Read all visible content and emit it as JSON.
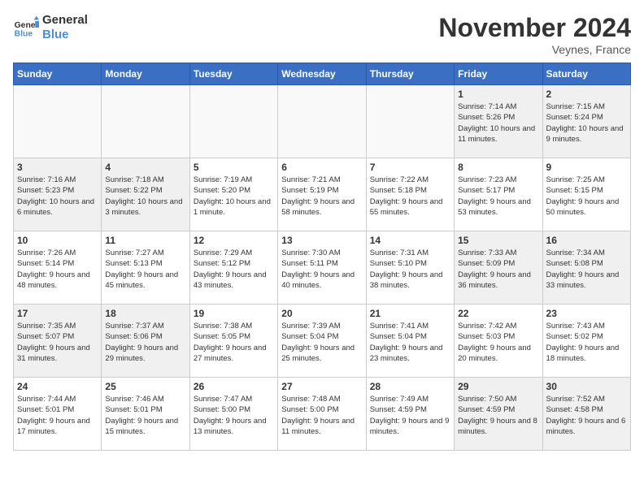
{
  "header": {
    "logo_general": "General",
    "logo_blue": "Blue",
    "month_title": "November 2024",
    "location": "Veynes, France"
  },
  "weekdays": [
    "Sunday",
    "Monday",
    "Tuesday",
    "Wednesday",
    "Thursday",
    "Friday",
    "Saturday"
  ],
  "weeks": [
    [
      {
        "day": "",
        "empty": true
      },
      {
        "day": "",
        "empty": true
      },
      {
        "day": "",
        "empty": true
      },
      {
        "day": "",
        "empty": true
      },
      {
        "day": "",
        "empty": true
      },
      {
        "day": "1",
        "sunrise": "Sunrise: 7:14 AM",
        "sunset": "Sunset: 5:26 PM",
        "daylight": "Daylight: 10 hours and 11 minutes."
      },
      {
        "day": "2",
        "sunrise": "Sunrise: 7:15 AM",
        "sunset": "Sunset: 5:24 PM",
        "daylight": "Daylight: 10 hours and 9 minutes."
      }
    ],
    [
      {
        "day": "3",
        "sunrise": "Sunrise: 7:16 AM",
        "sunset": "Sunset: 5:23 PM",
        "daylight": "Daylight: 10 hours and 6 minutes."
      },
      {
        "day": "4",
        "sunrise": "Sunrise: 7:18 AM",
        "sunset": "Sunset: 5:22 PM",
        "daylight": "Daylight: 10 hours and 3 minutes."
      },
      {
        "day": "5",
        "sunrise": "Sunrise: 7:19 AM",
        "sunset": "Sunset: 5:20 PM",
        "daylight": "Daylight: 10 hours and 1 minute."
      },
      {
        "day": "6",
        "sunrise": "Sunrise: 7:21 AM",
        "sunset": "Sunset: 5:19 PM",
        "daylight": "Daylight: 9 hours and 58 minutes."
      },
      {
        "day": "7",
        "sunrise": "Sunrise: 7:22 AM",
        "sunset": "Sunset: 5:18 PM",
        "daylight": "Daylight: 9 hours and 55 minutes."
      },
      {
        "day": "8",
        "sunrise": "Sunrise: 7:23 AM",
        "sunset": "Sunset: 5:17 PM",
        "daylight": "Daylight: 9 hours and 53 minutes."
      },
      {
        "day": "9",
        "sunrise": "Sunrise: 7:25 AM",
        "sunset": "Sunset: 5:15 PM",
        "daylight": "Daylight: 9 hours and 50 minutes."
      }
    ],
    [
      {
        "day": "10",
        "sunrise": "Sunrise: 7:26 AM",
        "sunset": "Sunset: 5:14 PM",
        "daylight": "Daylight: 9 hours and 48 minutes."
      },
      {
        "day": "11",
        "sunrise": "Sunrise: 7:27 AM",
        "sunset": "Sunset: 5:13 PM",
        "daylight": "Daylight: 9 hours and 45 minutes."
      },
      {
        "day": "12",
        "sunrise": "Sunrise: 7:29 AM",
        "sunset": "Sunset: 5:12 PM",
        "daylight": "Daylight: 9 hours and 43 minutes."
      },
      {
        "day": "13",
        "sunrise": "Sunrise: 7:30 AM",
        "sunset": "Sunset: 5:11 PM",
        "daylight": "Daylight: 9 hours and 40 minutes."
      },
      {
        "day": "14",
        "sunrise": "Sunrise: 7:31 AM",
        "sunset": "Sunset: 5:10 PM",
        "daylight": "Daylight: 9 hours and 38 minutes."
      },
      {
        "day": "15",
        "sunrise": "Sunrise: 7:33 AM",
        "sunset": "Sunset: 5:09 PM",
        "daylight": "Daylight: 9 hours and 36 minutes."
      },
      {
        "day": "16",
        "sunrise": "Sunrise: 7:34 AM",
        "sunset": "Sunset: 5:08 PM",
        "daylight": "Daylight: 9 hours and 33 minutes."
      }
    ],
    [
      {
        "day": "17",
        "sunrise": "Sunrise: 7:35 AM",
        "sunset": "Sunset: 5:07 PM",
        "daylight": "Daylight: 9 hours and 31 minutes."
      },
      {
        "day": "18",
        "sunrise": "Sunrise: 7:37 AM",
        "sunset": "Sunset: 5:06 PM",
        "daylight": "Daylight: 9 hours and 29 minutes."
      },
      {
        "day": "19",
        "sunrise": "Sunrise: 7:38 AM",
        "sunset": "Sunset: 5:05 PM",
        "daylight": "Daylight: 9 hours and 27 minutes."
      },
      {
        "day": "20",
        "sunrise": "Sunrise: 7:39 AM",
        "sunset": "Sunset: 5:04 PM",
        "daylight": "Daylight: 9 hours and 25 minutes."
      },
      {
        "day": "21",
        "sunrise": "Sunrise: 7:41 AM",
        "sunset": "Sunset: 5:04 PM",
        "daylight": "Daylight: 9 hours and 23 minutes."
      },
      {
        "day": "22",
        "sunrise": "Sunrise: 7:42 AM",
        "sunset": "Sunset: 5:03 PM",
        "daylight": "Daylight: 9 hours and 20 minutes."
      },
      {
        "day": "23",
        "sunrise": "Sunrise: 7:43 AM",
        "sunset": "Sunset: 5:02 PM",
        "daylight": "Daylight: 9 hours and 18 minutes."
      }
    ],
    [
      {
        "day": "24",
        "sunrise": "Sunrise: 7:44 AM",
        "sunset": "Sunset: 5:01 PM",
        "daylight": "Daylight: 9 hours and 17 minutes."
      },
      {
        "day": "25",
        "sunrise": "Sunrise: 7:46 AM",
        "sunset": "Sunset: 5:01 PM",
        "daylight": "Daylight: 9 hours and 15 minutes."
      },
      {
        "day": "26",
        "sunrise": "Sunrise: 7:47 AM",
        "sunset": "Sunset: 5:00 PM",
        "daylight": "Daylight: 9 hours and 13 minutes."
      },
      {
        "day": "27",
        "sunrise": "Sunrise: 7:48 AM",
        "sunset": "Sunset: 5:00 PM",
        "daylight": "Daylight: 9 hours and 11 minutes."
      },
      {
        "day": "28",
        "sunrise": "Sunrise: 7:49 AM",
        "sunset": "Sunset: 4:59 PM",
        "daylight": "Daylight: 9 hours and 9 minutes."
      },
      {
        "day": "29",
        "sunrise": "Sunrise: 7:50 AM",
        "sunset": "Sunset: 4:59 PM",
        "daylight": "Daylight: 9 hours and 8 minutes."
      },
      {
        "day": "30",
        "sunrise": "Sunrise: 7:52 AM",
        "sunset": "Sunset: 4:58 PM",
        "daylight": "Daylight: 9 hours and 6 minutes."
      }
    ]
  ]
}
